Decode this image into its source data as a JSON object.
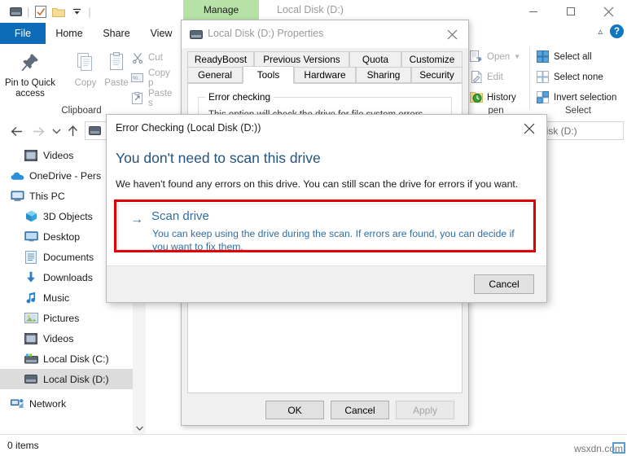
{
  "explorer": {
    "window_title": "Local Disk (D:)",
    "manage_tab": "Manage",
    "quick_access_icons": [
      "drive-icon",
      "properties-icon",
      "new-folder-icon",
      "customize-qat-chevron-icon"
    ],
    "window_controls": {
      "minimize": "minimize-icon",
      "maximize": "maximize-icon",
      "close": "close-icon"
    },
    "ribbon_tabs": [
      {
        "label": "File",
        "active": false
      },
      {
        "label": "Home",
        "active": true
      },
      {
        "label": "Share",
        "active": false
      },
      {
        "label": "View",
        "active": false
      }
    ],
    "help_button": "?",
    "ribbon": {
      "clipboard": {
        "group_label": "Clipboard",
        "pin_label": "Pin to Quick\naccess",
        "pin_line1": "Pin to Quick",
        "pin_line2": "access",
        "copy_label": "Copy",
        "paste_label": "Paste",
        "cut_label": "Cut",
        "copy_path_label": "Copy p",
        "paste_shortcut_label": "Paste s"
      },
      "open": {
        "group_label": "pen",
        "open_label": "Open",
        "edit_label": "Edit",
        "history_label": "History"
      },
      "select": {
        "group_label": "Select",
        "select_all_label": "Select all",
        "select_none_label": "Select none",
        "invert_selection_label": "Invert selection"
      }
    },
    "address_bar": {
      "value": "",
      "back": "back-arrow-icon",
      "forward": "forward-arrow-icon",
      "recent": "recent-locations-chevron-icon",
      "up": "up-arrow-icon"
    },
    "search": {
      "value": "Disk (D:)",
      "placeholder": "Search Local Disk (D:)"
    },
    "nav_pane": [
      {
        "label": "Videos",
        "icon": "videos-folder-icon",
        "indent": 1,
        "selected": false
      },
      {
        "label": "OneDrive - Pers",
        "icon": "onedrive-cloud-icon",
        "indent": 0,
        "selected": false
      },
      {
        "label": "This PC",
        "icon": "this-pc-icon",
        "indent": 0,
        "selected": false
      },
      {
        "label": "3D Objects",
        "icon": "3d-objects-icon",
        "indent": 1,
        "selected": false
      },
      {
        "label": "Desktop",
        "icon": "desktop-icon",
        "indent": 1,
        "selected": false
      },
      {
        "label": "Documents",
        "icon": "documents-icon",
        "indent": 1,
        "selected": false
      },
      {
        "label": "Downloads",
        "icon": "downloads-icon",
        "indent": 1,
        "selected": false
      },
      {
        "label": "Music",
        "icon": "music-icon",
        "indent": 1,
        "selected": false
      },
      {
        "label": "Pictures",
        "icon": "pictures-icon",
        "indent": 1,
        "selected": false
      },
      {
        "label": "Videos",
        "icon": "videos-folder-icon",
        "indent": 1,
        "selected": false
      },
      {
        "label": "Local Disk (C:)",
        "icon": "local-disk-c-icon",
        "indent": 1,
        "selected": false
      },
      {
        "label": "Local Disk (D:)",
        "icon": "local-disk-d-icon",
        "indent": 1,
        "selected": true
      },
      {
        "label": "Network",
        "icon": "network-icon",
        "indent": 0,
        "selected": false
      }
    ],
    "status_bar": {
      "items_text": "0 items"
    }
  },
  "properties_dialog": {
    "title": "Local Disk (D:) Properties",
    "title_icon": "drive-icon",
    "close_label": "✕",
    "tabs_row1": [
      "ReadyBoost",
      "Previous Versions",
      "Quota",
      "Customize"
    ],
    "tabs_row2": [
      "General",
      "Tools",
      "Hardware",
      "Sharing",
      "Security"
    ],
    "active_tab": "Tools",
    "error_checking_group": {
      "title": "Error checking",
      "text": "This option will check the drive for file system errors."
    },
    "buttons": [
      {
        "label": "OK",
        "disabled": false
      },
      {
        "label": "Cancel",
        "disabled": false
      },
      {
        "label": "Apply",
        "disabled": true
      }
    ]
  },
  "error_checking_dialog": {
    "title": "Error Checking (Local Disk (D:))",
    "close_label": "✕",
    "heading": "You don't need to scan this drive",
    "subtext": "We haven't found any errors on this drive. You can still scan the drive for errors if you want.",
    "command_link": {
      "arrow": "→",
      "title": "Scan drive",
      "description": "You can keep using the drive during the scan. If errors are found, you can decide if you want to fix them."
    },
    "cancel_label": "Cancel",
    "highlight_color": "#e40000",
    "link_color": "#2f6ea5",
    "heading_color": "#24547f"
  },
  "watermark": {
    "text": "wsxdn.com"
  }
}
